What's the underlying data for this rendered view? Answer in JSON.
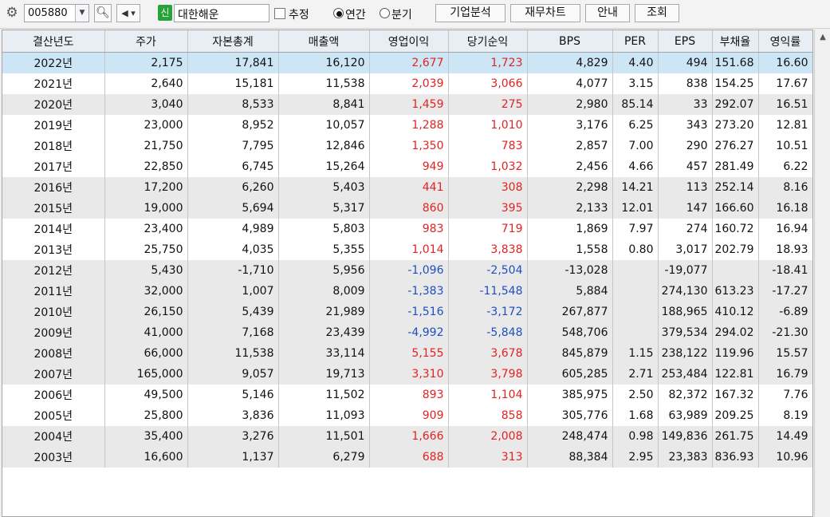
{
  "toolbar": {
    "code_value": "005880",
    "company_badge": "신",
    "company_name": "대한해운",
    "estimate_label": "추정",
    "annual_label": "연간",
    "quarter_label": "분기",
    "buttons": [
      "기업분석",
      "재무차트",
      "안내",
      "조회"
    ]
  },
  "table": {
    "columns": [
      "결산년도",
      "주가",
      "자본총계",
      "매출액",
      "영업이익",
      "당기순익",
      "BPS",
      "PER",
      "EPS",
      "부채율",
      "영익률"
    ],
    "rows": [
      [
        "2022년",
        "2,175",
        "17,841",
        "16,120",
        "2,677",
        "1,723",
        "4,829",
        "4.40",
        "494",
        "151.68",
        "16.60"
      ],
      [
        "2021년",
        "2,640",
        "15,181",
        "11,538",
        "2,039",
        "3,066",
        "4,077",
        "3.15",
        "838",
        "154.25",
        "17.67"
      ],
      [
        "2020년",
        "3,040",
        "8,533",
        "8,841",
        "1,459",
        "275",
        "2,980",
        "85.14",
        "33",
        "292.07",
        "16.51"
      ],
      [
        "2019년",
        "23,000",
        "8,952",
        "10,057",
        "1,288",
        "1,010",
        "3,176",
        "6.25",
        "343",
        "273.20",
        "12.81"
      ],
      [
        "2018년",
        "21,750",
        "7,795",
        "12,846",
        "1,350",
        "783",
        "2,857",
        "7.00",
        "290",
        "276.27",
        "10.51"
      ],
      [
        "2017년",
        "22,850",
        "6,745",
        "15,264",
        "949",
        "1,032",
        "2,456",
        "4.66",
        "457",
        "281.49",
        "6.22"
      ],
      [
        "2016년",
        "17,200",
        "6,260",
        "5,403",
        "441",
        "308",
        "2,298",
        "14.21",
        "113",
        "252.14",
        "8.16"
      ],
      [
        "2015년",
        "19,000",
        "5,694",
        "5,317",
        "860",
        "395",
        "2,133",
        "12.01",
        "147",
        "166.60",
        "16.18"
      ],
      [
        "2014년",
        "23,400",
        "4,989",
        "5,803",
        "983",
        "719",
        "1,869",
        "7.97",
        "274",
        "160.72",
        "16.94"
      ],
      [
        "2013년",
        "25,750",
        "4,035",
        "5,355",
        "1,014",
        "3,838",
        "1,558",
        "0.80",
        "3,017",
        "202.79",
        "18.93"
      ],
      [
        "2012년",
        "5,430",
        "-1,710",
        "5,956",
        "-1,096",
        "-2,504",
        "-13,028",
        "",
        "-19,077",
        "",
        "-18.41"
      ],
      [
        "2011년",
        "32,000",
        "1,007",
        "8,009",
        "-1,383",
        "-11,548",
        "5,884",
        "",
        "274,130",
        "613.23",
        "-17.27"
      ],
      [
        "2010년",
        "26,150",
        "5,439",
        "21,989",
        "-1,516",
        "-3,172",
        "267,877",
        "",
        "188,965",
        "410.12",
        "-6.89"
      ],
      [
        "2009년",
        "41,000",
        "7,168",
        "23,439",
        "-4,992",
        "-5,848",
        "548,706",
        "",
        "379,534",
        "294.02",
        "-21.30"
      ],
      [
        "2008년",
        "66,000",
        "11,538",
        "33,114",
        "5,155",
        "3,678",
        "845,879",
        "1.15",
        "238,122",
        "119.96",
        "15.57"
      ],
      [
        "2007년",
        "165,000",
        "9,057",
        "19,713",
        "3,310",
        "3,798",
        "605,285",
        "2.71",
        "253,484",
        "122.81",
        "16.79"
      ],
      [
        "2006년",
        "49,500",
        "5,146",
        "11,502",
        "893",
        "1,104",
        "385,975",
        "2.50",
        "82,372",
        "167.32",
        "7.76"
      ],
      [
        "2005년",
        "25,800",
        "3,836",
        "11,093",
        "909",
        "858",
        "305,776",
        "1.68",
        "63,989",
        "209.25",
        "8.19"
      ],
      [
        "2004년",
        "35,400",
        "3,276",
        "11,501",
        "1,666",
        "2,008",
        "248,474",
        "0.98",
        "149,836",
        "261.75",
        "14.49"
      ],
      [
        "2003년",
        "16,600",
        "1,137",
        "6,279",
        "688",
        "313",
        "88,384",
        "2.95",
        "23,383",
        "836.93",
        "10.96"
      ]
    ]
  },
  "colors": {
    "positive": "#e32222",
    "negative": "#1f4fbf",
    "selected_row": "#cde6f5"
  }
}
